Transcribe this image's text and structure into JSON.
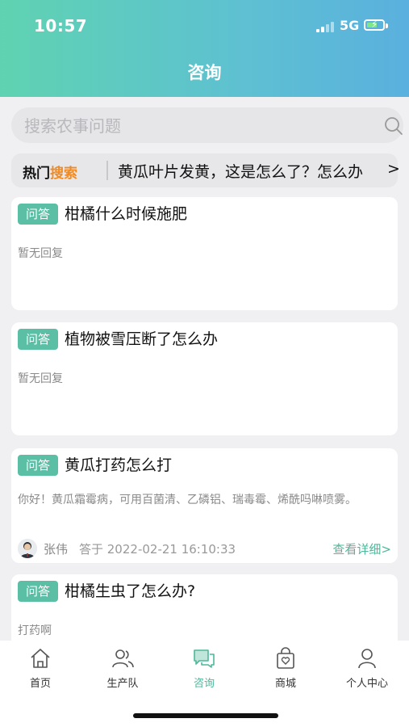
{
  "status_bar": {
    "time": "10:57",
    "network": "5G"
  },
  "header": {
    "title": "咨询"
  },
  "search": {
    "placeholder": "搜索农事问题"
  },
  "hot_search": {
    "label_prefix": "热门",
    "label_highlight": "搜索",
    "text": "黄瓜叶片发黄，这是怎么了？怎么办",
    "arrow": ">"
  },
  "questions": [
    {
      "tag": "问答",
      "title": "柑橘什么时候施肥",
      "reply": "暂无回复"
    },
    {
      "tag": "问答",
      "title": "植物被雪压断了怎么办",
      "reply": "暂无回复"
    },
    {
      "tag": "问答",
      "title": "黄瓜打药怎么打",
      "answer": "你好！黄瓜霜霉病，可用百菌清、乙磷铝、瑞毒霉、烯酰吗啉喷雾。",
      "author": "张伟",
      "answered_at": "答于 2022-02-21 16:10:33",
      "detail_link": "查看详细>"
    },
    {
      "tag": "问答",
      "title": "柑橘生虫了怎么办?",
      "reply": "打药啊"
    }
  ],
  "tabs": [
    {
      "label": "首页",
      "icon": "home-icon"
    },
    {
      "label": "生产队",
      "icon": "team-icon"
    },
    {
      "label": "咨询",
      "icon": "chat-icon",
      "active": true
    },
    {
      "label": "商城",
      "icon": "shop-bag-icon"
    },
    {
      "label": "个人中心",
      "icon": "person-icon"
    }
  ],
  "colors": {
    "accent": "#4eb89a",
    "tag_bg": "#5abfa5",
    "hot_highlight": "#f08a24"
  }
}
